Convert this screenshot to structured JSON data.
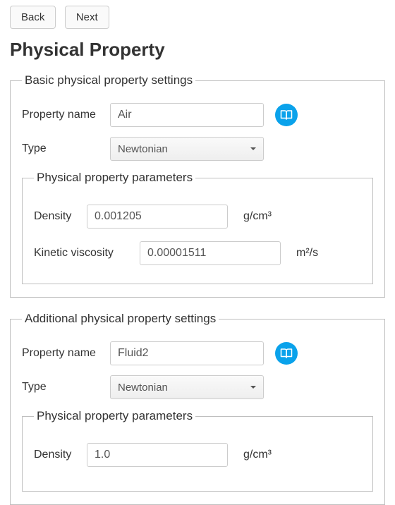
{
  "nav": {
    "back": "Back",
    "next": "Next"
  },
  "pageTitle": "Physical Property",
  "basic": {
    "legend": "Basic physical property settings",
    "propNameLabel": "Property name",
    "propNameValue": "Air",
    "typeLabel": "Type",
    "typeValue": "Newtonian",
    "params": {
      "legend": "Physical property parameters",
      "densityLabel": "Density",
      "densityValue": "0.001205",
      "densityUnit": "g/cm³",
      "viscLabel": "Kinetic viscosity",
      "viscValue": "0.00001511",
      "viscUnit": "m²/s"
    }
  },
  "additional": {
    "legend": "Additional physical property settings",
    "propNameLabel": "Property name",
    "propNameValue": "Fluid2",
    "typeLabel": "Type",
    "typeValue": "Newtonian",
    "params": {
      "legend": "Physical property parameters",
      "densityLabel": "Density",
      "densityValue": "1.0",
      "densityUnit": "g/cm³"
    }
  }
}
